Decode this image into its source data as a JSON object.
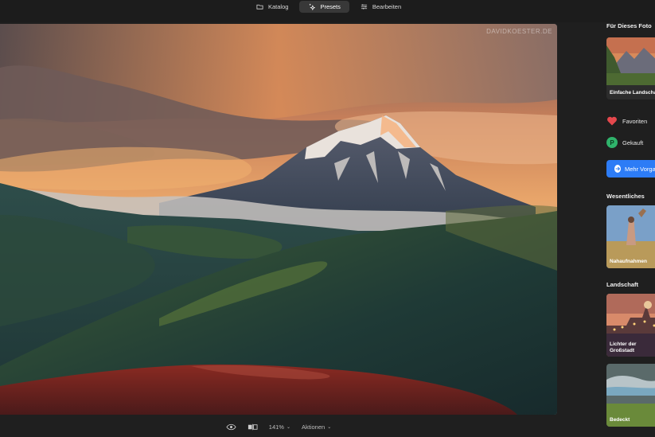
{
  "tabs": [
    {
      "label": "Katalog",
      "icon": "folder-icon",
      "active": false
    },
    {
      "label": "Presets",
      "icon": "sparkle-icon",
      "active": true
    },
    {
      "label": "Bearbeiten",
      "icon": "sliders-icon",
      "active": false
    }
  ],
  "photo": {
    "watermark": "DAVIDKOESTER.DE"
  },
  "bottombar": {
    "zoom": "141%",
    "actions": "Aktionen"
  },
  "sidebar": {
    "section_this_photo": "Für Dieses Foto",
    "preset_this_photo": "Einfache Landschaft",
    "favorites": "Favoriten",
    "purchased": "Gekauft",
    "more_button": "Mehr Vorgaben",
    "section_essentials": "Wesentliches",
    "preset_essentials": "Nahaufnahmen",
    "section_landscape": "Landschaft",
    "preset_city_line1": "Lichter der",
    "preset_city_line2": "Großstadt",
    "preset_overcast": "Bedeckt"
  },
  "colors": {
    "accent": "#2d7cf6",
    "favorite": "#e5484d",
    "purchased": "#2fb36b"
  }
}
